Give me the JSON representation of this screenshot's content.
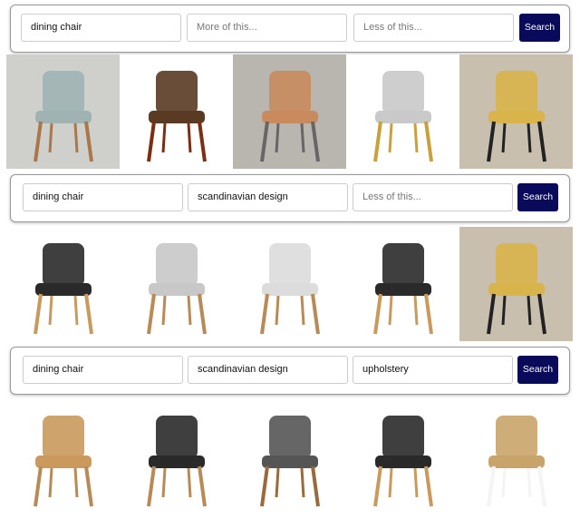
{
  "searches": [
    {
      "query": "dining chair",
      "more": "",
      "more_placeholder": "More of this...",
      "less": "",
      "less_placeholder": "Less of this...",
      "button": "Search"
    },
    {
      "query": "dining chair",
      "more": "scandinavian design",
      "more_placeholder": "More of this...",
      "less": "",
      "less_placeholder": "Less of this...",
      "button": "Search"
    },
    {
      "query": "dining chair",
      "more": "scandinavian design",
      "more_placeholder": "More of this...",
      "less": "upholstery",
      "less_placeholder": "Less of this...",
      "button": "Search"
    }
  ],
  "results": [
    [
      {
        "bg": "#cfd0cc",
        "seat": "#9fb3b3",
        "frame": "#a9774a"
      },
      {
        "bg": "#ffffff",
        "seat": "#5a3a22",
        "frame": "#7a2e12"
      },
      {
        "bg": "#b9b6b0",
        "seat": "#c98b5e",
        "frame": "#666"
      },
      {
        "bg": "#ffffff",
        "seat": "#c9c9c9",
        "frame": "#c9a13a"
      },
      {
        "bg": "#c8bfae",
        "seat": "#d9b44a",
        "frame": "#222"
      }
    ],
    [
      {
        "bg": "#ffffff",
        "seat": "#2a2a2a",
        "frame": "#c99a5c"
      },
      {
        "bg": "#ffffff",
        "seat": "#c8c8c8",
        "frame": "#b88a55"
      },
      {
        "bg": "#ffffff",
        "seat": "#dcdcdc",
        "frame": "#b88a55"
      },
      {
        "bg": "#ffffff",
        "seat": "#2a2a2a",
        "frame": "#c99a5c"
      },
      {
        "bg": "#c8bfae",
        "seat": "#d9b44a",
        "frame": "#222"
      }
    ],
    [
      {
        "bg": "#ffffff",
        "seat": "#c99a5c",
        "frame": "#b88a55"
      },
      {
        "bg": "#ffffff",
        "seat": "#2a2a2a",
        "frame": "#b88a55"
      },
      {
        "bg": "#ffffff",
        "seat": "#555",
        "frame": "#9a6a3a"
      },
      {
        "bg": "#ffffff",
        "seat": "#2a2a2a",
        "frame": "#c99a5c"
      },
      {
        "bg": "#ffffff",
        "seat": "#c9a46a",
        "frame": "#f4f4f4"
      }
    ]
  ]
}
